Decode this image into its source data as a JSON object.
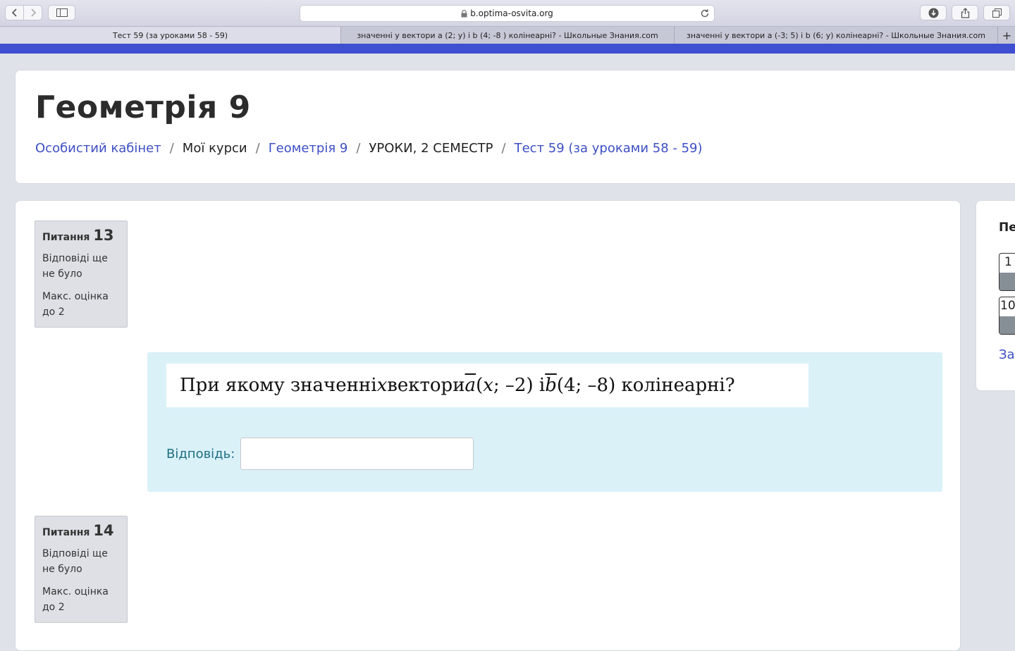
{
  "browser": {
    "url": "b.optima-osvita.org",
    "tabs": [
      {
        "label": "Тест 59 (за уроками 58 - 59)"
      },
      {
        "label": "значенні у вектори а (2; у) і b (4; -8 ) колінеарні? - Школьные Знания.com"
      },
      {
        "label": "значенні у вектори а (-3; 5) і b (6; у) колінеарні? - Школьные Знания.com"
      }
    ],
    "newtab_label": "+"
  },
  "header": {
    "title": "Геометрія 9",
    "breadcrumb": {
      "item0": "Особистий кабінет",
      "item1": "Мої курси",
      "item2": "Геометрія 9",
      "item3": "УРОКИ, 2 СЕМЕСТР",
      "item4": "Тест 59 (за уроками 58 - 59)",
      "separator": "/"
    }
  },
  "questions": [
    {
      "label": "Питання",
      "number": "13",
      "state": "Відповіді ще не було",
      "grade": "Макс. оцінка до 2"
    },
    {
      "label": "Питання",
      "number": "14",
      "state": "Відповіді ще не було",
      "grade": "Макс. оцінка до 2"
    }
  ],
  "question13": {
    "text": {
      "t1": "При якому значенні ",
      "x": "x",
      "t2": " вектори ",
      "a": "a",
      "t3": " (",
      "ax": "x",
      "t4": "; –2) і ",
      "b": "b",
      "t5": " (4; –8) колінеарні?"
    },
    "answer_label": "Відповідь:",
    "answer_value": ""
  },
  "quiz_nav": {
    "title": "Пе",
    "buttons": [
      {
        "label": "1"
      },
      {
        "label": "10"
      }
    ],
    "link": "За"
  },
  "colors": {
    "accent": "#3e4fd0",
    "link": "#3d4fc4",
    "formulation_bg": "#daf1f8",
    "answered_fill": "#868e96"
  }
}
